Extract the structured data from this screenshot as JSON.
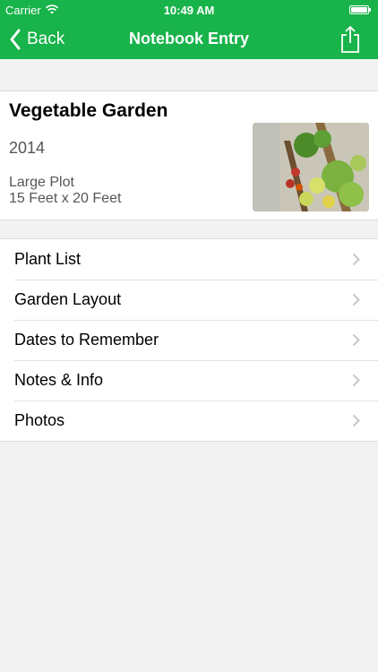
{
  "status": {
    "carrier": "Carrier",
    "time": "10:49 AM"
  },
  "nav": {
    "back_label": "Back",
    "title": "Notebook Entry"
  },
  "entry": {
    "title": "Vegetable Garden",
    "year": "2014",
    "plot_type": "Large Plot",
    "dimensions": "15 Feet x 20 Feet"
  },
  "menu": [
    {
      "label": "Plant List"
    },
    {
      "label": "Garden Layout"
    },
    {
      "label": "Dates to Remember"
    },
    {
      "label": "Notes & Info"
    },
    {
      "label": "Photos"
    }
  ],
  "colors": {
    "accent": "#18b34a",
    "background": "#f2f2f2"
  },
  "icons": [
    "wifi-icon",
    "battery-icon",
    "back-chevron-icon",
    "share-icon",
    "chevron-right-icon"
  ]
}
